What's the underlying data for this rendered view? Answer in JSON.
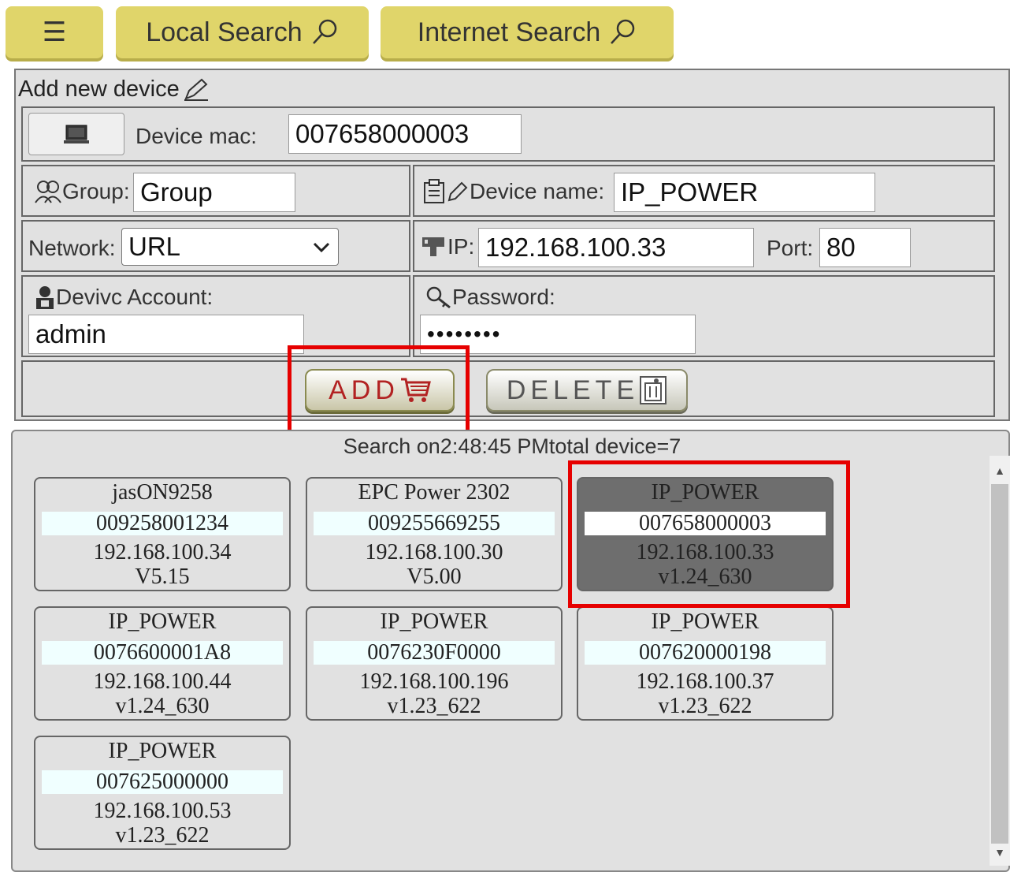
{
  "toolbar": {
    "menu_label": "☰",
    "local_search_label": "Local Search",
    "internet_search_label": "Internet Search"
  },
  "form": {
    "title": "Add new device",
    "mac_label": "Device mac:",
    "mac_value": "007658000003",
    "group_label": "Group:",
    "group_value": "Group",
    "device_name_label": "Device name:",
    "device_name_value": "IP_POWER",
    "network_label": "Network:",
    "network_value": "URL",
    "ip_label": "IP:",
    "ip_value": "192.168.100.33",
    "port_label": "Port:",
    "port_value": "80",
    "account_label": "Devivc Account:",
    "account_value": "admin",
    "password_label": "Password:",
    "password_value": "••••••••",
    "add_label": "ADD",
    "delete_label": "DELETE"
  },
  "results": {
    "status": "Search on2:48:45 PMtotal device=7",
    "devices": [
      {
        "name": "jasON9258",
        "mac": "009258001234",
        "ip": "192.168.100.34",
        "fw": "V5.15"
      },
      {
        "name": "EPC Power 2302",
        "mac": "009255669255",
        "ip": "192.168.100.30",
        "fw": "V5.00"
      },
      {
        "name": "IP_POWER",
        "mac": "007658000003",
        "ip": "192.168.100.33",
        "fw": "v1.24_630"
      },
      {
        "name": "IP_POWER",
        "mac": "0076600001A8",
        "ip": "192.168.100.44",
        "fw": "v1.24_630"
      },
      {
        "name": "IP_POWER",
        "mac": "0076230F0000",
        "ip": "192.168.100.196",
        "fw": "v1.23_622"
      },
      {
        "name": "IP_POWER",
        "mac": "007620000198",
        "ip": "192.168.100.37",
        "fw": "v1.23_622"
      },
      {
        "name": "IP_POWER",
        "mac": "007625000000",
        "ip": "192.168.100.53",
        "fw": "v1.23_622"
      }
    ]
  },
  "colors": {
    "toolbar_button": "#e0d56a",
    "panel_bg": "#e1e1e1",
    "selected_card": "#6e6e6e",
    "highlight": "#e60000",
    "add_text": "#b22222"
  },
  "icons": {
    "search": "magnifier-icon",
    "edit": "pencil-icon",
    "monitor": "monitor-icon",
    "group": "people-icon",
    "device_name": "clipboard-icon",
    "ip": "network-plug-icon",
    "account": "user-icon",
    "password": "key-icon",
    "add": "cart-icon",
    "delete": "trash-icon"
  }
}
